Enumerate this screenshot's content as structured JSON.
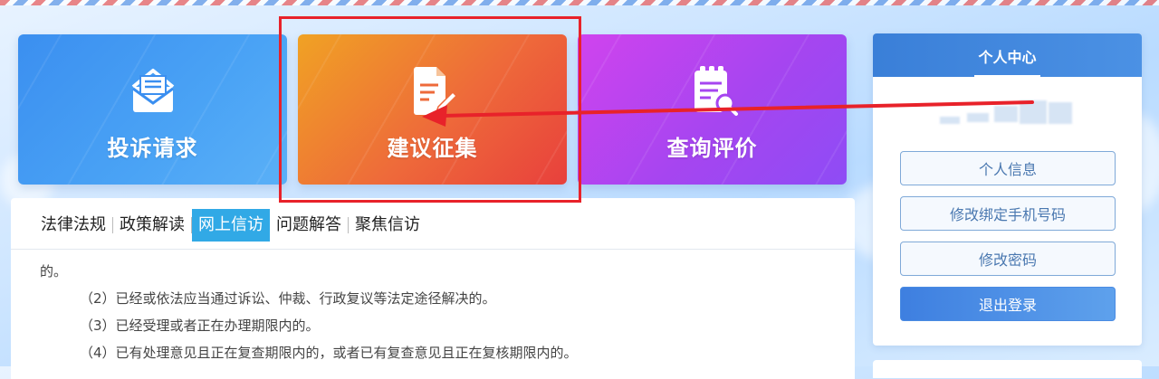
{
  "cards": [
    {
      "label": "投诉请求",
      "icon": "envelope-icon"
    },
    {
      "label": "建议征集",
      "icon": "document-edit-icon"
    },
    {
      "label": "查询评价",
      "icon": "clipboard-search-icon"
    }
  ],
  "sidebar": {
    "title": "个人中心",
    "buttons": [
      "个人信息",
      "修改绑定手机号码",
      "修改密码",
      "退出登录"
    ]
  },
  "tabs": [
    "法律法规",
    "政策解读",
    "网上信访",
    "问题解答",
    "聚焦信访"
  ],
  "active_tab": "网上信访",
  "content_lines": [
    "的。",
    "（2）已经或依法应当通过诉讼、仲裁、行政复议等法定途径解决的。",
    "（3）已经受理或者正在办理期限内的。",
    "（4）已有处理意见且正在复查期限内的，或者已有复查意见且正在复核期限内的。"
  ],
  "colors": {
    "card_blue": "#3b8ff0",
    "card_orange": "#ee6a3a",
    "card_purple": "#a645f0",
    "highlight": "#e8222a",
    "tab_active": "#31a9e6",
    "sidebar_head": "#3a7fd8"
  }
}
